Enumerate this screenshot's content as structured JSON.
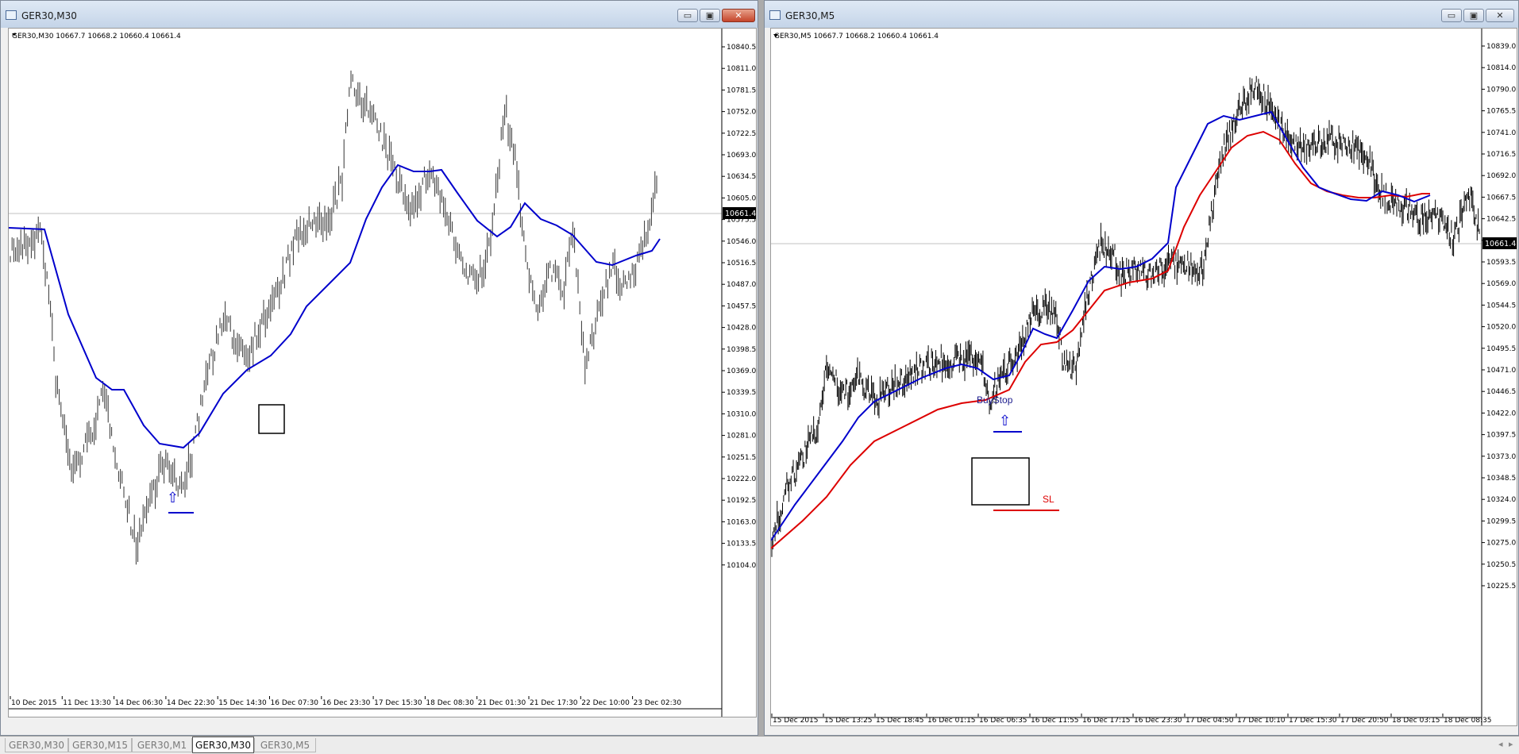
{
  "windows": [
    {
      "id": "left",
      "title": "GER30,M30",
      "info": "GER30,M30  10667.7 10668.2 10660.4 10661.4",
      "price_label": "10661.4",
      "y_ticks": [
        "10840.5",
        "10811.0",
        "10781.5",
        "10752.0",
        "10722.5",
        "10693.0",
        "10634.5",
        "10605.0",
        "10575.5",
        "10546.0",
        "10516.5",
        "10487.0",
        "10457.5",
        "10428.0",
        "10398.5",
        "10369.0",
        "10339.5",
        "10310.0",
        "10281.0",
        "10251.5",
        "10222.0",
        "10192.5",
        "10163.0",
        "10133.5",
        "10104.0"
      ],
      "x_ticks": [
        "10 Dec 2015",
        "11 Dec 13:30",
        "14 Dec 06:30",
        "14 Dec 22:30",
        "15 Dec 14:30",
        "16 Dec 07:30",
        "16 Dec 23:30",
        "17 Dec 15:30",
        "18 Dec 08:30",
        "21 Dec 01:30",
        "21 Dec 17:30",
        "22 Dec 10:00",
        "23 Dec 02:30"
      ],
      "arrow_label": "⇧",
      "ma_color": "#0000cc"
    },
    {
      "id": "right",
      "title": "GER30,M5",
      "info": "GER30,M5  10667.7 10668.2 10660.4 10661.4",
      "price_label": "10661.4",
      "y_ticks": [
        "10839.0",
        "10814.0",
        "10790.0",
        "10765.5",
        "10741.0",
        "10716.5",
        "10692.0",
        "10667.5",
        "10642.5",
        "10618.0",
        "10593.5",
        "10569.0",
        "10544.5",
        "10520.0",
        "10495.5",
        "10471.0",
        "10446.5",
        "10422.0",
        "10397.5",
        "10373.0",
        "10348.5",
        "10324.0",
        "10299.5",
        "10275.0",
        "10250.5",
        "10225.5"
      ],
      "x_ticks": [
        "15 Dec 2015",
        "15 Dec 13:25",
        "15 Dec 18:45",
        "16 Dec 01:15",
        "16 Dec 06:35",
        "16 Dec 11:55",
        "16 Dec 17:15",
        "16 Dec 23:30",
        "17 Dec 04:50",
        "17 Dec 10:10",
        "17 Dec 15:30",
        "17 Dec 20:50",
        "18 Dec 03:15",
        "18 Dec 08:35"
      ],
      "buystop_label": "BuyStop",
      "sl_label": "SL",
      "arrow_label": "⇧",
      "ma_fast_color": "#0000cc",
      "ma_slow_color": "#dd0000"
    }
  ],
  "tabs": [
    {
      "label": "GER30,M30",
      "active": false
    },
    {
      "label": "GER30,M15",
      "active": false
    },
    {
      "label": "GER30,M1",
      "active": false
    },
    {
      "label": "GER30,M30",
      "active": true
    },
    {
      "label": "GER30,M5",
      "active": false
    }
  ],
  "window_buttons": {
    "minimize": "▭",
    "maximize": "▣",
    "close": "✕"
  },
  "nav_arrows": {
    "left": "◂",
    "right": "▸"
  }
}
